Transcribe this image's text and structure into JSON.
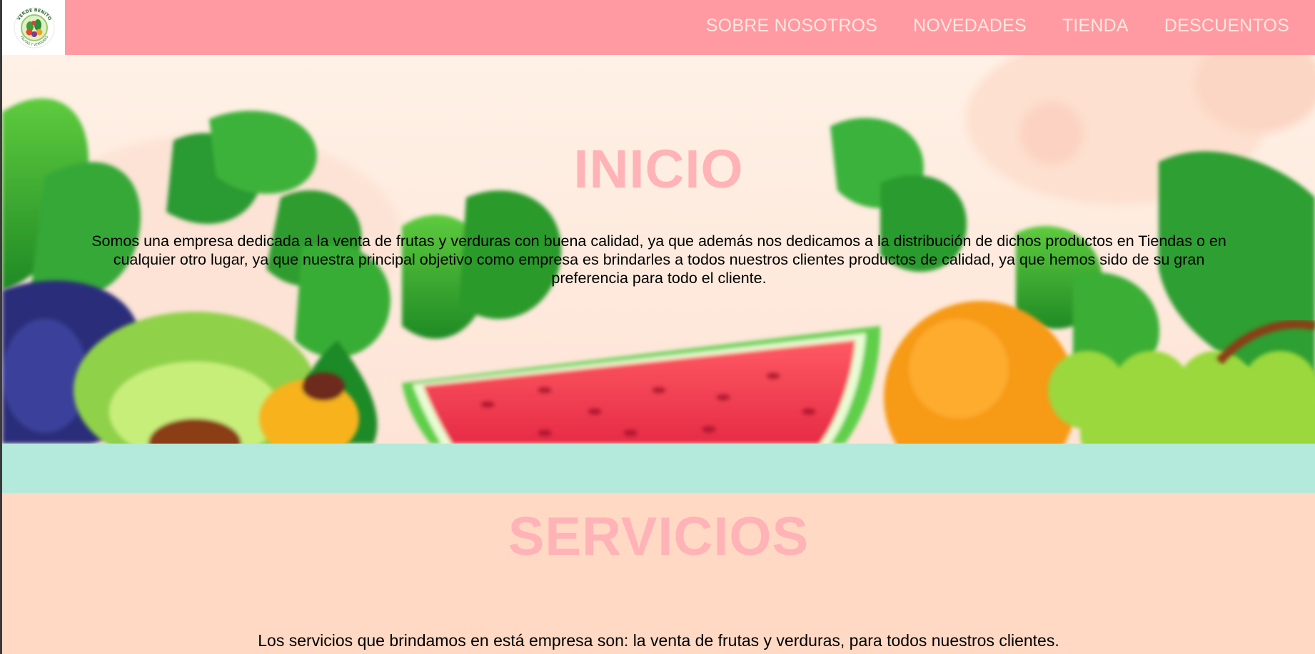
{
  "header": {
    "logo": {
      "icon": "verde-benito-logo",
      "top_text": "VERDE BENITO",
      "bottom_text": "FRUTAS Y VERDURAS"
    },
    "nav": [
      {
        "label": "SOBRE NOSOTROS"
      },
      {
        "label": "NOVEDADES"
      },
      {
        "label": "TIENDA"
      },
      {
        "label": "DESCUENTOS"
      }
    ],
    "color": "#ff9aa2"
  },
  "hero": {
    "title": "INICIO",
    "text": "Somos una empresa dedicada a la venta de frutas y verduras con buena calidad, ya que además nos dedicamos a la distribución de dichos productos en Tiendas o en cualquier otro lugar, ya que nuestra principal objetivo como empresa es brindarles a todos nuestros clientes productos de calidad, ya que hemos sido de su gran preferencia para todo el cliente.",
    "background_image": "fruits-and-vegetables-illustration"
  },
  "services": {
    "title": "SERVICIOS",
    "text": "Los servicios que brindamos en está empresa son: la venta de frutas y verduras, para todos nuestros clientes."
  },
  "colors": {
    "accent_pink": "#ffb3b7",
    "teal_band": "#b4eadb",
    "peach_bg": "#ffd9c4"
  }
}
